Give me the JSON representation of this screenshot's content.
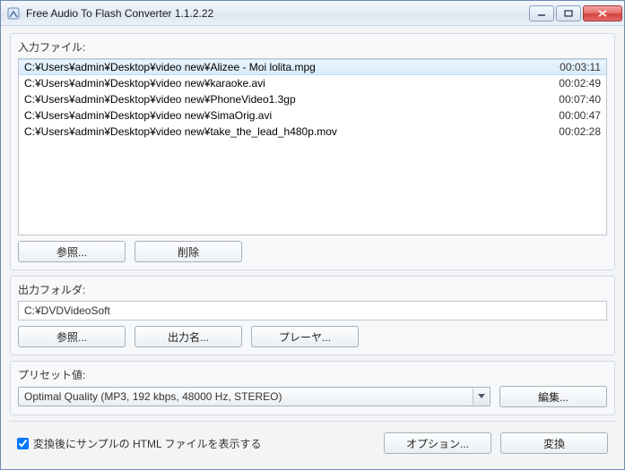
{
  "window": {
    "title": "Free Audio To Flash Converter 1.1.2.22"
  },
  "input_section_label": "入力ファイル:",
  "files": [
    {
      "path": "C:¥Users¥admin¥Desktop¥video new¥Alizee - Moi lolita.mpg",
      "duration": "00:03:11",
      "selected": true
    },
    {
      "path": "C:¥Users¥admin¥Desktop¥video new¥karaoke.avi",
      "duration": "00:02:49",
      "selected": false
    },
    {
      "path": "C:¥Users¥admin¥Desktop¥video new¥PhoneVideo1.3gp",
      "duration": "00:07:40",
      "selected": false
    },
    {
      "path": "C:¥Users¥admin¥Desktop¥video new¥SimaOrig.avi",
      "duration": "00:00:47",
      "selected": false
    },
    {
      "path": "C:¥Users¥admin¥Desktop¥video new¥take_the_lead_h480p.mov",
      "duration": "00:02:28",
      "selected": false
    }
  ],
  "buttons": {
    "browse_input": "参照...",
    "delete": "削除",
    "browse_output": "参照...",
    "output_name": "出力名...",
    "player": "プレーヤ...",
    "edit": "編集...",
    "options": "オプション...",
    "convert": "変換"
  },
  "output_section_label": "出力フォルダ:",
  "output_folder": "C:¥DVDVideoSoft",
  "preset_section_label": "プリセット値:",
  "preset_selected": "Optimal Quality (MP3, 192 kbps, 48000 Hz, STEREO)",
  "checkbox_label": "変換後にサンプルの HTML ファイルを表示する",
  "checkbox_checked": true
}
